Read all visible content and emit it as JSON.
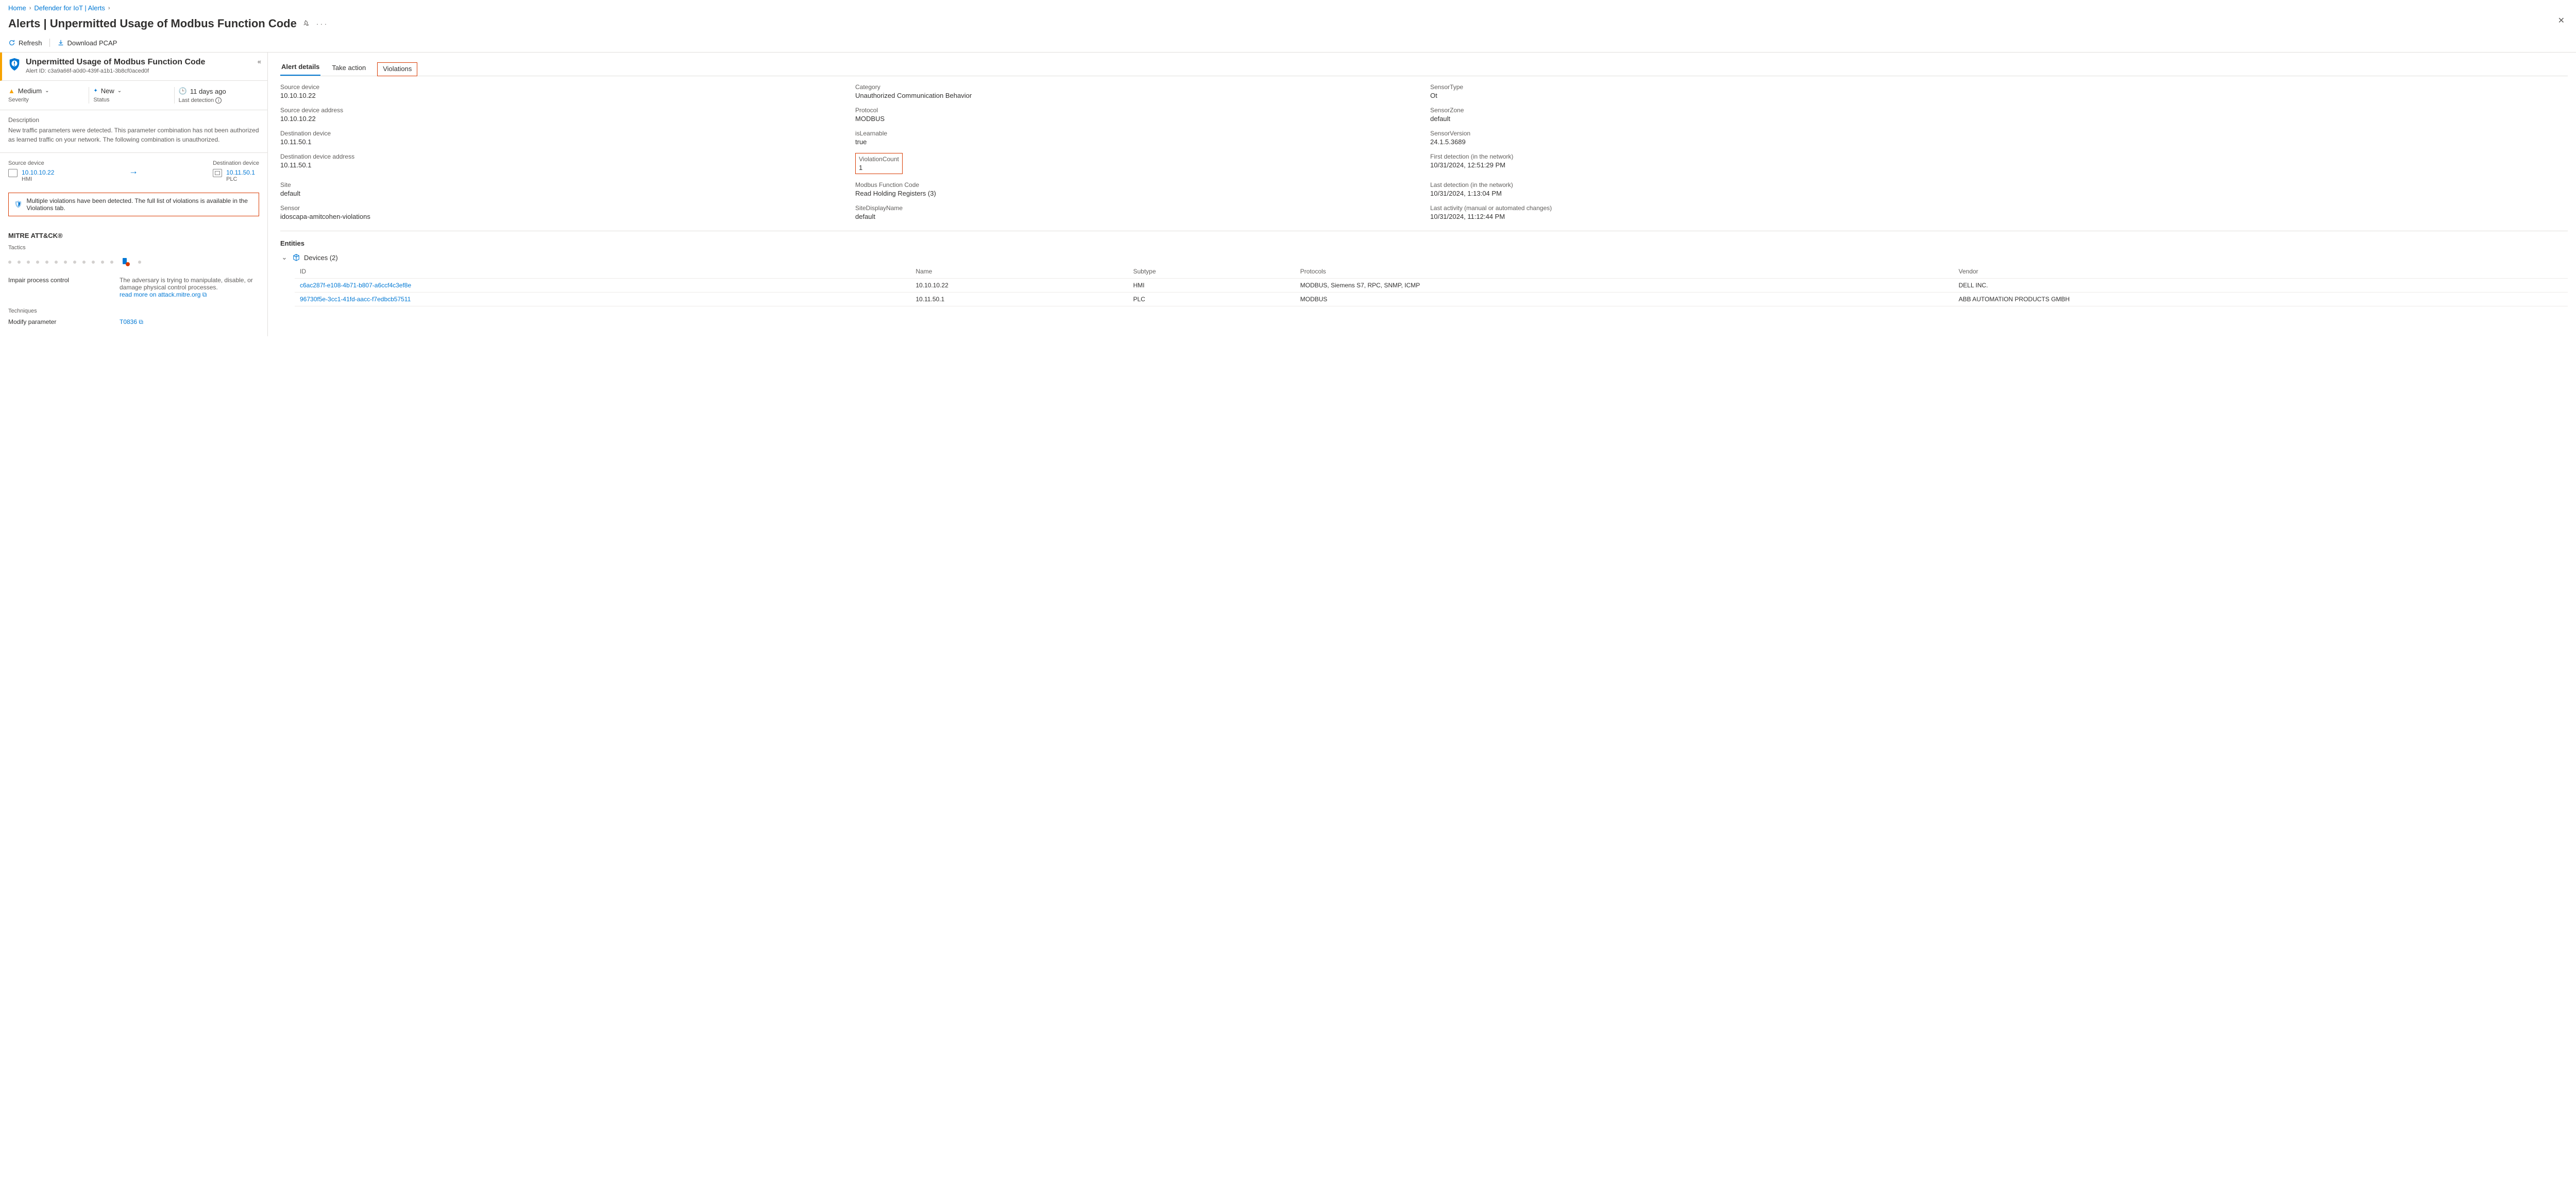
{
  "breadcrumb": {
    "home": "Home",
    "mid": "Defender for IoT | Alerts"
  },
  "page": {
    "title": "Alerts | Unpermitted Usage of Modbus Function Code",
    "refresh": "Refresh",
    "download": "Download PCAP"
  },
  "alert": {
    "name": "Unpermitted Usage of Modbus Function Code",
    "id_label": "Alert ID: c3a9a66f-a0d0-439f-a1b1-3b8cf0aced0f",
    "severity_value": "Medium",
    "severity_label": "Severity",
    "status_value": "New",
    "status_label": "Status",
    "detection_value": "11 days ago",
    "detection_label": "Last detection"
  },
  "description": {
    "label": "Description",
    "text": "New traffic parameters were detected. This parameter combination has not been authorized as learned traffic on your network. The following combination is unauthorized."
  },
  "devices": {
    "src_label": "Source device",
    "src_ip": "10.10.10.22",
    "src_type": "HMI",
    "dst_label": "Destination device",
    "dst_ip": "10.11.50.1",
    "dst_type": "PLC"
  },
  "violation_banner": "Multiple violations have been detected. The full list of violations is available in the Violations tab.",
  "mitre": {
    "heading": "MITRE ATT&CK®",
    "tactics_label": "Tactics",
    "tactic": "Impair process control",
    "tactic_desc": "The adversary is trying to manipulate, disable, or damage physical control processes.",
    "read_more": "read more on attack.mitre.org",
    "techniques_label": "Techniques",
    "technique": "Modify parameter",
    "technique_id": "T0836"
  },
  "tabs": {
    "details": "Alert details",
    "take": "Take action",
    "violations": "Violations"
  },
  "details": [
    {
      "k": "Source device",
      "v": "10.10.10.22"
    },
    {
      "k": "Category",
      "v": "Unauthorized Communication Behavior"
    },
    {
      "k": "SensorType",
      "v": "Ot"
    },
    {
      "k": "",
      "v": ""
    },
    {
      "k": "Source device address",
      "v": "10.10.10.22"
    },
    {
      "k": "Protocol",
      "v": "MODBUS"
    },
    {
      "k": "SensorZone",
      "v": "default"
    },
    {
      "k": "",
      "v": ""
    },
    {
      "k": "Destination device",
      "v": "10.11.50.1"
    },
    {
      "k": "isLearnable",
      "v": "true"
    },
    {
      "k": "SensorVersion",
      "v": "24.1.5.3689"
    },
    {
      "k": "",
      "v": ""
    },
    {
      "k": "Destination device address",
      "v": "10.11.50.1"
    },
    {
      "k": "ViolationCount",
      "v": "1",
      "red": true
    },
    {
      "k": "First detection (in the network)",
      "v": "10/31/2024, 12:51:29 PM"
    },
    {
      "k": "",
      "v": ""
    },
    {
      "k": "Site",
      "v": "default"
    },
    {
      "k": "Modbus Function Code",
      "v": "Read Holding Registers (3)"
    },
    {
      "k": "Last detection (in the network)",
      "v": "10/31/2024, 1:13:04 PM"
    },
    {
      "k": "",
      "v": ""
    },
    {
      "k": "Sensor",
      "v": "idoscapa-amitcohen-violations"
    },
    {
      "k": "SiteDisplayName",
      "v": "default"
    },
    {
      "k": "Last activity (manual or automated changes)",
      "v": "10/31/2024, 11:12:44 PM"
    },
    {
      "k": "",
      "v": ""
    }
  ],
  "entities": {
    "heading": "Entities",
    "devices_label": "Devices (2)",
    "cols": {
      "id": "ID",
      "name": "Name",
      "subtype": "Subtype",
      "protocols": "Protocols",
      "vendor": "Vendor"
    },
    "rows": [
      {
        "id": "c6ac287f-e108-4b71-b807-a6ccf4c3ef8e",
        "name": "10.10.10.22",
        "subtype": "HMI",
        "protocols": "MODBUS, Siemens S7, RPC, SNMP, ICMP",
        "vendor": "DELL INC."
      },
      {
        "id": "96730f5e-3cc1-41fd-aacc-f7edbcb57511",
        "name": "10.11.50.1",
        "subtype": "PLC",
        "protocols": "MODBUS",
        "vendor": "ABB AUTOMATION PRODUCTS GMBH"
      }
    ]
  }
}
